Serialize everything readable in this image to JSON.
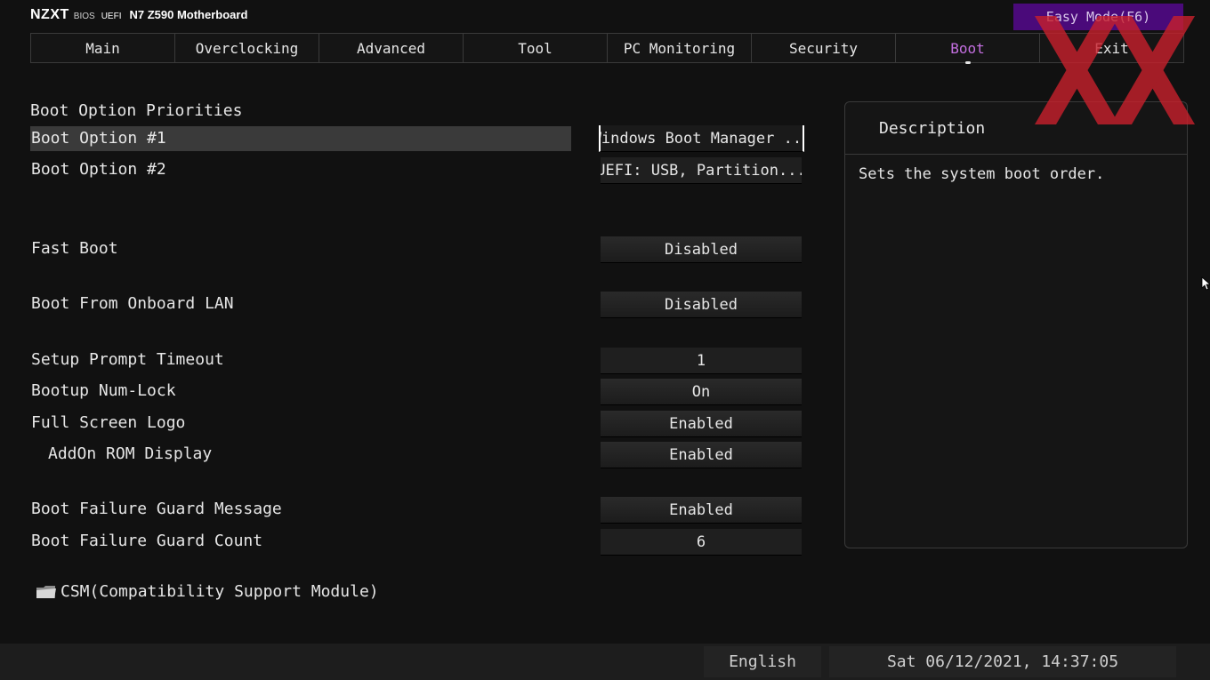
{
  "header": {
    "logo": "NZXT",
    "bios": "BIOS",
    "uefi": "UEFI",
    "model": "N7 Z590 Motherboard",
    "easy_mode": "Easy Mode(F6)"
  },
  "tabs": [
    {
      "label": "Main"
    },
    {
      "label": "Overclocking"
    },
    {
      "label": "Advanced"
    },
    {
      "label": "Tool"
    },
    {
      "label": "PC Monitoring"
    },
    {
      "label": "Security"
    },
    {
      "label": "Boot",
      "active": true
    },
    {
      "label": "Exit"
    }
  ],
  "boot": {
    "section_title": "Boot Option Priorities",
    "rows": [
      {
        "label": "Boot Option #1",
        "value": "Windows Boot Manager ..."
      },
      {
        "label": "Boot Option #2",
        "value": "UEFI:  USB, Partition..."
      },
      {
        "label": "Fast Boot",
        "value": "Disabled"
      },
      {
        "label": "Boot From Onboard LAN",
        "value": "Disabled"
      },
      {
        "label": "Setup Prompt Timeout",
        "value": "1"
      },
      {
        "label": "Bootup Num-Lock",
        "value": "On"
      },
      {
        "label": "Full Screen Logo",
        "value": "Enabled"
      },
      {
        "label": "AddOn ROM Display",
        "value": "Enabled"
      },
      {
        "label": "Boot Failure Guard Message",
        "value": "Enabled"
      },
      {
        "label": "Boot Failure Guard Count",
        "value": "6"
      }
    ],
    "csm_label": "CSM(Compatibility Support Module)"
  },
  "description": {
    "title": "Description",
    "text": "Sets the system boot order."
  },
  "footer": {
    "language": "English",
    "datetime": "Sat 06/12/2021, 14:37:05"
  },
  "colors": {
    "accent": "#c46fe0",
    "easy_mode_bg": "#4a0a7a",
    "watermark": "#c8202c"
  }
}
